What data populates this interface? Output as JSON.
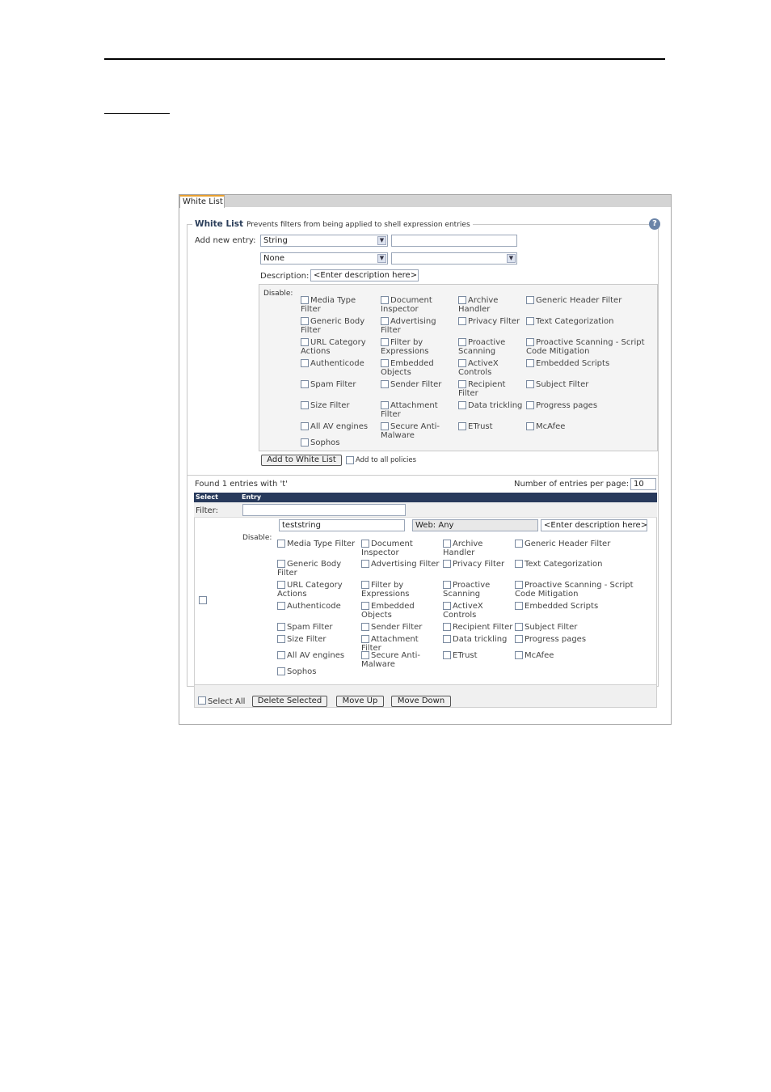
{
  "tab": {
    "label": "White List"
  },
  "section": {
    "title": "White List",
    "description": "Prevents filters from being applied to shell expression entries",
    "help": "?"
  },
  "add_entry": {
    "label": "Add new entry:",
    "type_select": "String",
    "value_input": "",
    "second_select": "None",
    "third_select": "",
    "description_label": "Description:",
    "description_value": "<Enter description here>",
    "disable_label": "Disable:"
  },
  "filters_top": [
    {
      "label": "Media Type Filter"
    },
    {
      "label": "Document Inspector"
    },
    {
      "label": "Archive Handler"
    },
    {
      "label": "Generic Header Filter"
    },
    {
      "label": "Generic Body Filter"
    },
    {
      "label": "Advertising Filter"
    },
    {
      "label": "Privacy Filter"
    },
    {
      "label": "Text Categorization"
    },
    {
      "label": "URL Category Actions"
    },
    {
      "label": "Filter by Expressions"
    },
    {
      "label": "Proactive Scanning"
    },
    {
      "label": "Proactive Scanning - Script Code Mitigation"
    },
    {
      "label": "Authenticode"
    },
    {
      "label": "Embedded Objects"
    },
    {
      "label": "ActiveX Controls"
    },
    {
      "label": "Embedded Scripts"
    },
    {
      "label": "Spam Filter"
    },
    {
      "label": "Sender Filter"
    },
    {
      "label": "Recipient Filter"
    },
    {
      "label": "Subject Filter"
    },
    {
      "label": "Size Filter"
    },
    {
      "label": "Attachment Filter"
    },
    {
      "label": "Data trickling"
    },
    {
      "label": "Progress pages"
    },
    {
      "label": "All AV engines"
    },
    {
      "label": "Secure Anti-Malware"
    },
    {
      "label": "ETrust"
    },
    {
      "label": "McAfee"
    },
    {
      "label": "Sophos"
    }
  ],
  "actions": {
    "add_button": "Add to White List",
    "add_all_label": "Add to all policies"
  },
  "results": {
    "found_text": "Found 1 entries with 't'",
    "per_page_label": "Number of entries per page:",
    "per_page_value": "10",
    "col_select": "Select",
    "col_entry": "Entry",
    "filter_label": "Filter:",
    "filter_value": ""
  },
  "entry": {
    "value": "teststring",
    "scope": "Web: Any",
    "description": "<Enter description here>",
    "disable_label": "Disable:",
    "filters": [
      {
        "label": "Media Type Filter"
      },
      {
        "label": "Document Inspector"
      },
      {
        "label": "Archive Handler"
      },
      {
        "label": "Generic Header Filter"
      },
      {
        "label": "Generic Body Filter"
      },
      {
        "label": "Advertising Filter"
      },
      {
        "label": "Privacy Filter"
      },
      {
        "label": "Text Categorization"
      },
      {
        "label": "URL Category Actions"
      },
      {
        "label": "Filter by Expressions"
      },
      {
        "label": "Proactive Scanning"
      },
      {
        "label": "Proactive Scanning - Script Code Mitigation"
      },
      {
        "label": "Authenticode"
      },
      {
        "label": "Embedded Objects"
      },
      {
        "label": "ActiveX Controls"
      },
      {
        "label": "Embedded Scripts"
      },
      {
        "label": "Spam Filter"
      },
      {
        "label": "Sender Filter"
      },
      {
        "label": "Recipient Filter"
      },
      {
        "label": "Subject Filter"
      },
      {
        "label": "Size Filter"
      },
      {
        "label": "Attachment Filter"
      },
      {
        "label": "Data trickling"
      },
      {
        "label": "Progress pages"
      },
      {
        "label": "All AV engines"
      },
      {
        "label": "Secure Anti-Malware"
      },
      {
        "label": "ETrust"
      },
      {
        "label": "McAfee"
      },
      {
        "label": "Sophos"
      }
    ]
  },
  "footer": {
    "select_all": "Select All",
    "delete": "Delete Selected",
    "move_up": "Move Up",
    "move_down": "Move Down"
  }
}
